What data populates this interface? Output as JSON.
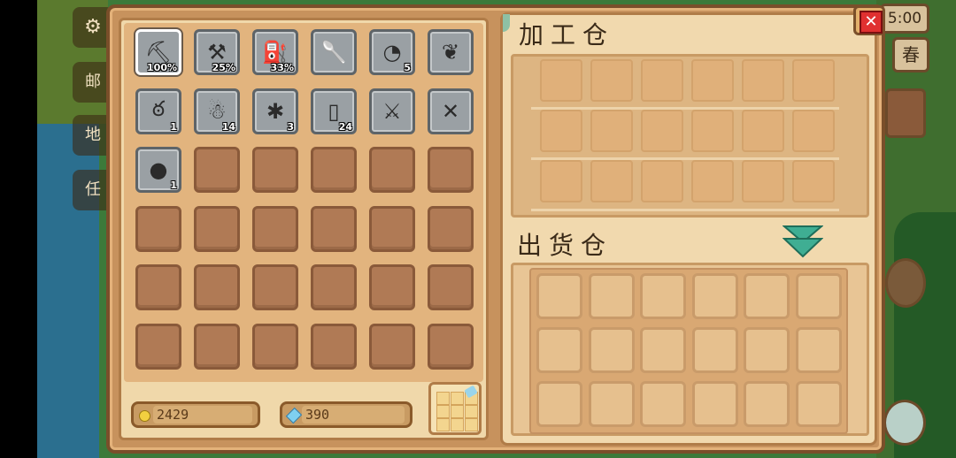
{
  "hud": {
    "time": "5:00",
    "season": "春",
    "left_labels": [
      "邮",
      "地",
      "任"
    ]
  },
  "inventory": {
    "items": [
      {
        "icon": "pickaxe-icon",
        "glyph": "⛏",
        "qty": "100%",
        "selected": true
      },
      {
        "icon": "hoe-icon",
        "glyph": "⚒",
        "qty": "25%"
      },
      {
        "icon": "watering-can-icon",
        "glyph": "⛽",
        "qty": "33%"
      },
      {
        "icon": "shovel-icon",
        "glyph": "🥄",
        "qty": ""
      },
      {
        "icon": "shell-icon",
        "glyph": "◔",
        "qty": "5"
      },
      {
        "icon": "ore-icon",
        "glyph": "❦",
        "qty": ""
      },
      {
        "icon": "cherry-icon",
        "glyph": "ఠ",
        "qty": "1"
      },
      {
        "icon": "creature-icon",
        "glyph": "☃",
        "qty": "14"
      },
      {
        "icon": "beetle-icon",
        "glyph": "✱",
        "qty": "3"
      },
      {
        "icon": "milk-bottle-icon",
        "glyph": "▯",
        "qty": "24"
      },
      {
        "icon": "sword-icon",
        "glyph": "⚔",
        "qty": ""
      },
      {
        "icon": "crossed-sword-icon",
        "glyph": "✕",
        "qty": ""
      },
      {
        "icon": "egg-icon",
        "glyph": "●",
        "qty": "1"
      }
    ],
    "total_slots": 36
  },
  "currency": {
    "gold": "2429",
    "gems": "390"
  },
  "processing": {
    "title": "加工仓"
  },
  "shipping": {
    "title": "出货仓"
  },
  "colors": {
    "frame": "#c7925d",
    "panel": "#f0d8aa",
    "empty_slot": "#b07a55",
    "filled_slot": "#9aa0a4",
    "arrow": "#3fae93",
    "close": "#e03030"
  }
}
